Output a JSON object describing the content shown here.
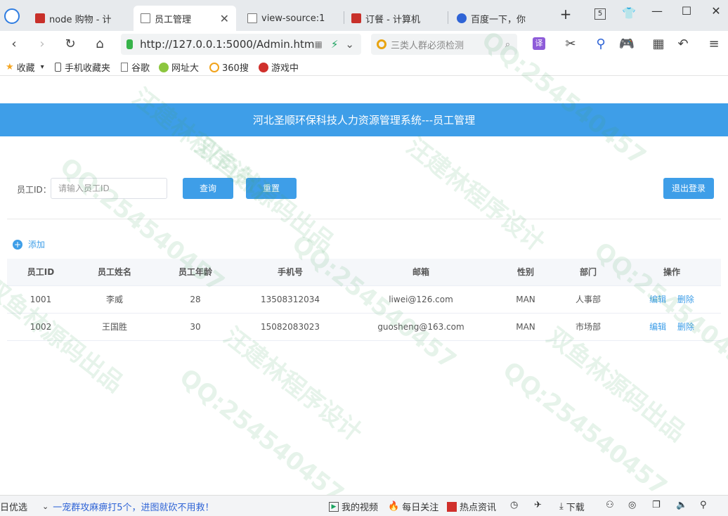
{
  "browser": {
    "tabs": [
      {
        "label": "node 购物 - 计",
        "active": false
      },
      {
        "label": "员工管理",
        "active": true
      },
      {
        "label": "view-source:1",
        "active": false
      },
      {
        "label": "订餐 - 计算机",
        "active": false
      },
      {
        "label": "百度一下，你",
        "active": false
      }
    ],
    "new_tab": "+",
    "tab_count": "5",
    "url": "http://127.0.0.1:5000/Admin.htm",
    "search_placeholder": "三类人群必须检测",
    "translate_label": "译",
    "bookmarks": [
      {
        "label": "收藏",
        "icon": "star-icon"
      },
      {
        "label": "手机收藏夹",
        "icon": "phone-icon"
      },
      {
        "label": "谷歌",
        "icon": "page-icon"
      },
      {
        "label": "网址大",
        "icon": "site-icon"
      },
      {
        "label": "360搜",
        "icon": "search360-icon"
      },
      {
        "label": "游戏中",
        "icon": "game-icon"
      }
    ]
  },
  "page": {
    "header_title": "河北圣顺环保科技人力资源管理系统---员工管理",
    "search": {
      "label": "员工ID：",
      "placeholder": "请输入员工ID",
      "query_button": "查询",
      "reset_button": "重置",
      "logout_button": "退出登录"
    },
    "add_label": "添加",
    "table": {
      "headers": [
        "员工ID",
        "员工姓名",
        "员工年龄",
        "手机号",
        "邮箱",
        "性别",
        "部门",
        "操作"
      ],
      "rows": [
        {
          "id": "1001",
          "name": "李威",
          "age": "28",
          "phone": "13508312034",
          "email": "liwei@126.com",
          "gender": "MAN",
          "dept": "人事部",
          "edit": "编辑",
          "delete": "删除"
        },
        {
          "id": "1002",
          "name": "王国胜",
          "age": "30",
          "phone": "15082083023",
          "email": "guosheng@163.com",
          "gender": "MAN",
          "dept": "市场部",
          "edit": "编辑",
          "delete": "删除"
        }
      ]
    }
  },
  "statusbar": {
    "left_label": "日优选",
    "news": "一宠群攻麻痹打5个，进图就砍不用救！",
    "my_video": "我的视频",
    "daily": "每日关注",
    "hot": "热点资讯",
    "download": "下载"
  },
  "watermark": {
    "qq": "QQ:254540457",
    "author": "汪建林程序设计",
    "source": "双鱼林源码出品"
  },
  "colors": {
    "accent": "#3e9ee8",
    "tab_bar": "#e7eaed"
  }
}
